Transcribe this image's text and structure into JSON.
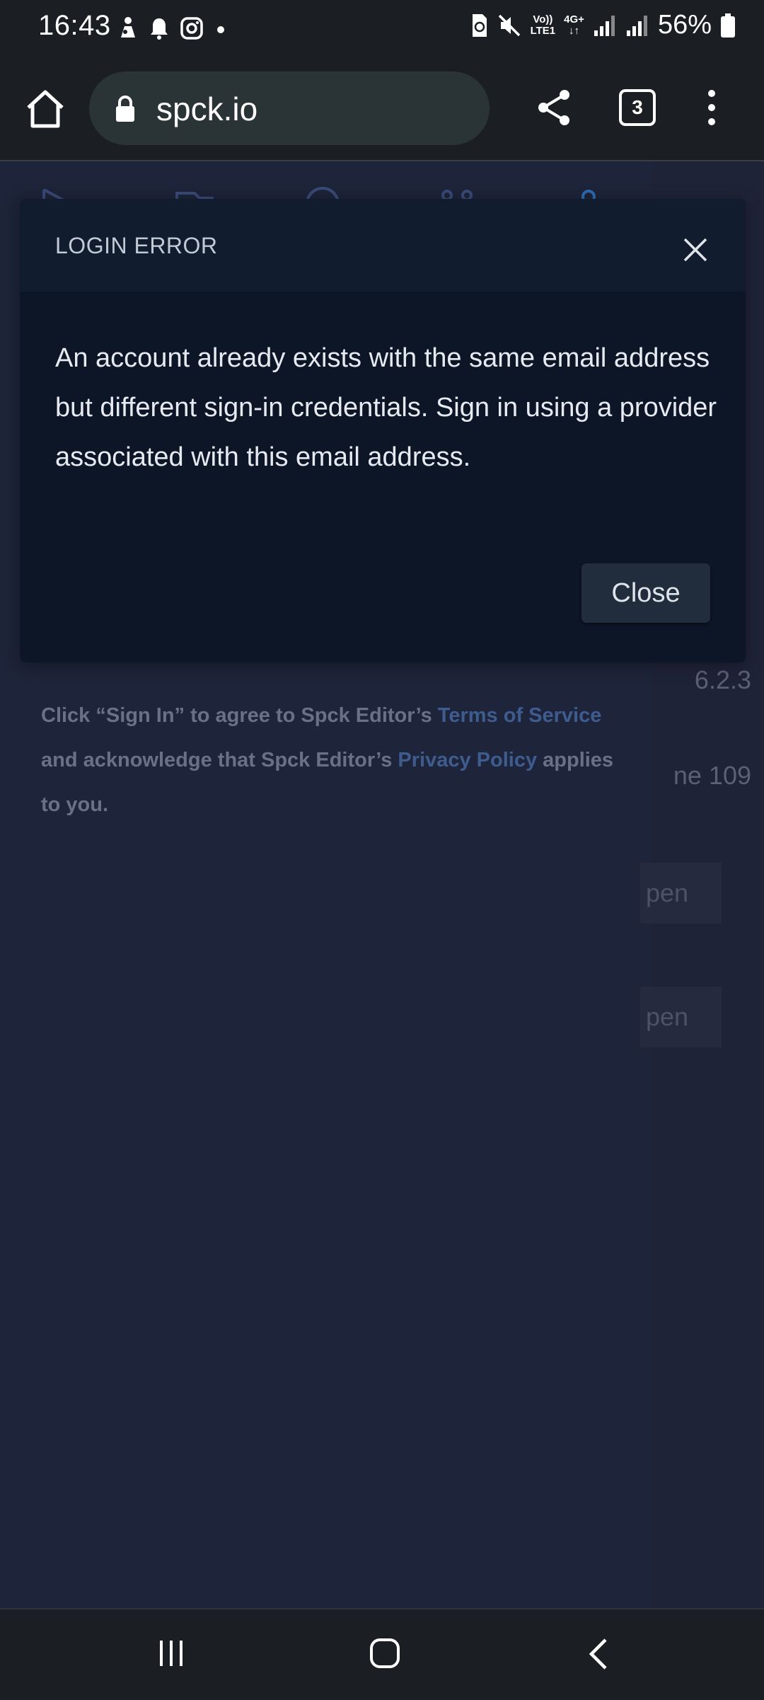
{
  "status_bar": {
    "time": "16:43",
    "left_icons": [
      "game-notification-icon",
      "bell-icon",
      "instagram-icon",
      "dot-icon"
    ],
    "volte_top": "Vo))",
    "volte_bottom": "LTE1",
    "network_type": "4G+",
    "battery_percent": "56%"
  },
  "browser": {
    "url": "spck.io",
    "tab_count": "3"
  },
  "dialog": {
    "title": "LOGIN ERROR",
    "message": "An account already exists with the same email address but different sign-in credentials. Sign in using a provider associated with this email address.",
    "close_button_label": "Close"
  },
  "background_page": {
    "version_text": "6.2.3",
    "lines_text": "ne 109",
    "open_button_1": "pen",
    "open_button_2": "pen",
    "legal": {
      "text_1": "Click “Sign In” to agree to Spck Editor’s ",
      "link_terms": "Terms of Service",
      "text_2": " and acknowledge that Spck Editor’s ",
      "link_privacy": "Privacy Policy",
      "text_3": " applies to you."
    }
  },
  "colors": {
    "page_background": "#1e2439",
    "dialog_background": "#0d1627",
    "link": "#3f5c8e",
    "browser_chrome": "#1b1e22"
  }
}
